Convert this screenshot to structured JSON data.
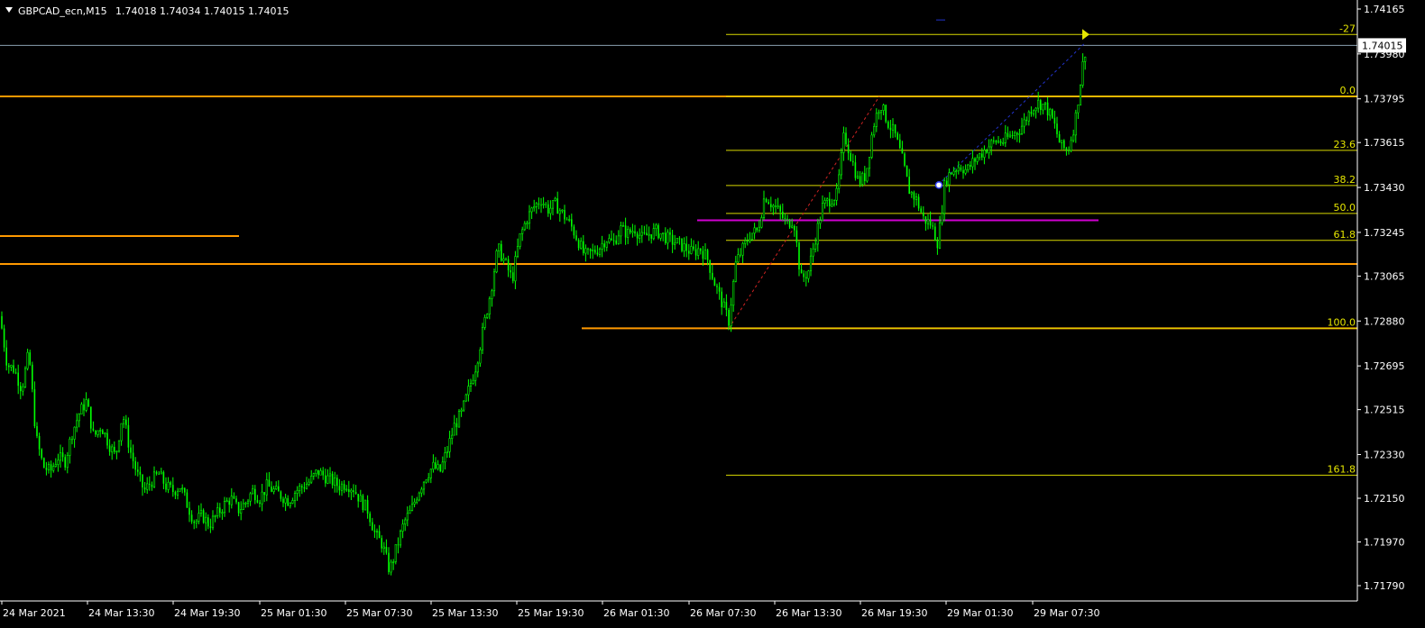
{
  "header": {
    "symbol_line": "GBPCAD_ecn,M15",
    "ohlc_line": "1.74018 1.74034 1.74015 1.74015"
  },
  "colors": {
    "background": "#000000",
    "candle": "#00ff00",
    "axis": "#ffffff",
    "fib": "#d8d800",
    "orange_level": "#ff9900",
    "magenta_level": "#d000d0",
    "bid_line": "#8aa0b0"
  },
  "chart_data": {
    "type": "candlestick",
    "title": "GBPCAD_ecn,M15",
    "ylim": [
      1.717,
      1.7425
    ],
    "y_ticks": [
      "1.74165",
      "1.73980",
      "1.73795",
      "1.73615",
      "1.73430",
      "1.73245",
      "1.73065",
      "1.72880",
      "1.72695",
      "1.72515",
      "1.72330",
      "1.72150",
      "1.71970",
      "1.71790"
    ],
    "x_ticks": [
      "24 Mar 2021",
      "24 Mar 13:30",
      "24 Mar 19:30",
      "25 Mar 01:30",
      "25 Mar 07:30",
      "25 Mar 13:30",
      "25 Mar 19:30",
      "26 Mar 01:30",
      "26 Mar 07:30",
      "26 Mar 13:30",
      "26 Mar 19:30",
      "29 Mar 01:30",
      "29 Mar 07:30"
    ],
    "current_price": "1.74015",
    "close_path": [
      [
        0,
        1.729
      ],
      [
        8,
        1.727
      ],
      [
        16,
        1.7268
      ],
      [
        24,
        1.726
      ],
      [
        32,
        1.7275
      ],
      [
        40,
        1.724
      ],
      [
        48,
        1.7228
      ],
      [
        56,
        1.7226
      ],
      [
        64,
        1.7232
      ],
      [
        72,
        1.723
      ],
      [
        80,
        1.7242
      ],
      [
        88,
        1.725
      ],
      [
        96,
        1.7255
      ],
      [
        104,
        1.724
      ],
      [
        112,
        1.7245
      ],
      [
        120,
        1.7238
      ],
      [
        128,
        1.7232
      ],
      [
        136,
        1.725
      ],
      [
        144,
        1.7235
      ],
      [
        152,
        1.7225
      ],
      [
        160,
        1.7218
      ],
      [
        168,
        1.7222
      ],
      [
        176,
        1.7225
      ],
      [
        184,
        1.722
      ],
      [
        192,
        1.7218
      ],
      [
        200,
        1.722
      ],
      [
        208,
        1.7212
      ],
      [
        216,
        1.7205
      ],
      [
        224,
        1.7208
      ],
      [
        232,
        1.7204
      ],
      [
        240,
        1.7208
      ],
      [
        248,
        1.7212
      ],
      [
        256,
        1.7215
      ],
      [
        264,
        1.721
      ],
      [
        272,
        1.7213
      ],
      [
        280,
        1.7218
      ],
      [
        288,
        1.7215
      ],
      [
        296,
        1.722
      ],
      [
        304,
        1.7218
      ],
      [
        312,
        1.7216
      ],
      [
        320,
        1.7214
      ],
      [
        328,
        1.7218
      ],
      [
        336,
        1.722
      ],
      [
        344,
        1.7222
      ],
      [
        352,
        1.7226
      ],
      [
        360,
        1.7224
      ],
      [
        368,
        1.7222
      ],
      [
        376,
        1.722
      ],
      [
        384,
        1.7221
      ],
      [
        392,
        1.7219
      ],
      [
        400,
        1.7214
      ],
      [
        408,
        1.721
      ],
      [
        416,
        1.72
      ],
      [
        424,
        1.7196
      ],
      [
        432,
        1.7185
      ],
      [
        440,
        1.7195
      ],
      [
        448,
        1.7205
      ],
      [
        456,
        1.721
      ],
      [
        464,
        1.7218
      ],
      [
        472,
        1.7224
      ],
      [
        480,
        1.7228
      ],
      [
        488,
        1.7226
      ],
      [
        496,
        1.7235
      ],
      [
        504,
        1.7245
      ],
      [
        512,
        1.725
      ],
      [
        520,
        1.726
      ],
      [
        528,
        1.727
      ],
      [
        536,
        1.7285
      ],
      [
        544,
        1.73
      ],
      [
        552,
        1.7318
      ],
      [
        560,
        1.7312
      ],
      [
        568,
        1.7305
      ],
      [
        576,
        1.7322
      ],
      [
        584,
        1.733
      ],
      [
        592,
        1.7335
      ],
      [
        600,
        1.7338
      ],
      [
        608,
        1.7334
      ],
      [
        616,
        1.7336
      ],
      [
        624,
        1.7332
      ],
      [
        632,
        1.7328
      ],
      [
        640,
        1.7322
      ],
      [
        648,
        1.7315
      ],
      [
        656,
        1.7316
      ],
      [
        664,
        1.7318
      ],
      [
        672,
        1.7322
      ],
      [
        680,
        1.732
      ],
      [
        688,
        1.7326
      ],
      [
        696,
        1.7324
      ],
      [
        704,
        1.7326
      ],
      [
        712,
        1.7322
      ],
      [
        720,
        1.7324
      ],
      [
        728,
        1.7325
      ],
      [
        736,
        1.7323
      ],
      [
        744,
        1.7321
      ],
      [
        752,
        1.732
      ],
      [
        760,
        1.7318
      ],
      [
        768,
        1.7316
      ],
      [
        776,
        1.7318
      ],
      [
        784,
        1.7314
      ],
      [
        792,
        1.7304
      ],
      [
        800,
        1.7296
      ],
      [
        808,
        1.7288
      ],
      [
        816,
        1.7312
      ],
      [
        824,
        1.7318
      ],
      [
        832,
        1.7324
      ],
      [
        840,
        1.7325
      ],
      [
        848,
        1.734
      ],
      [
        856,
        1.7336
      ],
      [
        864,
        1.7333
      ],
      [
        872,
        1.7328
      ],
      [
        880,
        1.733
      ],
      [
        888,
        1.7305
      ],
      [
        896,
        1.7308
      ],
      [
        904,
        1.7322
      ],
      [
        912,
        1.7335
      ],
      [
        920,
        1.7338
      ],
      [
        928,
        1.734
      ],
      [
        936,
        1.7365
      ],
      [
        944,
        1.7355
      ],
      [
        952,
        1.7345
      ],
      [
        960,
        1.7348
      ],
      [
        968,
        1.7368
      ],
      [
        976,
        1.7378
      ],
      [
        984,
        1.737
      ],
      [
        992,
        1.7365
      ],
      [
        1000,
        1.7355
      ],
      [
        1008,
        1.7342
      ],
      [
        1016,
        1.7338
      ],
      [
        1024,
        1.733
      ],
      [
        1032,
        1.7328
      ],
      [
        1040,
        1.732
      ],
      [
        1048,
        1.7346
      ],
      [
        1056,
        1.735
      ],
      [
        1064,
        1.7352
      ],
      [
        1072,
        1.735
      ],
      [
        1080,
        1.7354
      ],
      [
        1088,
        1.7357
      ],
      [
        1096,
        1.736
      ],
      [
        1104,
        1.7362
      ],
      [
        1112,
        1.7362
      ],
      [
        1120,
        1.7364
      ],
      [
        1128,
        1.7366
      ],
      [
        1136,
        1.737
      ],
      [
        1144,
        1.7376
      ],
      [
        1152,
        1.7378
      ],
      [
        1160,
        1.7376
      ],
      [
        1168,
        1.737
      ],
      [
        1176,
        1.736
      ],
      [
        1184,
        1.7358
      ],
      [
        1192,
        1.737
      ],
      [
        1200,
        1.7392
      ],
      [
        1204,
        1.7401
      ]
    ],
    "fibonacci": [
      {
        "label": "-27",
        "price": 1.7406
      },
      {
        "label": "0.0",
        "price": 1.73805
      },
      {
        "label": "23.6",
        "price": 1.73583
      },
      {
        "label": "38.2",
        "price": 1.73438
      },
      {
        "label": "50.0",
        "price": 1.73323
      },
      {
        "label": "61.8",
        "price": 1.73212
      },
      {
        "label": "100.0",
        "price": 1.7285
      },
      {
        "label": "161.8",
        "price": 1.72245
      }
    ],
    "horizontal_levels": [
      {
        "price": 1.73805,
        "from": 0,
        "to": 1505,
        "color": "#ff9900"
      },
      {
        "price": 1.7323,
        "from": 0,
        "to": 265,
        "color": "#ff9900"
      },
      {
        "price": 1.73115,
        "from": 0,
        "to": 1505,
        "color": "#ff9900"
      },
      {
        "price": 1.7285,
        "from": 645,
        "to": 1505,
        "color": "#ff9900"
      },
      {
        "price": 1.73295,
        "from": 773,
        "to": 1218,
        "color": "#d000d0"
      }
    ],
    "trendlines": [
      {
        "from": [
          808,
          1.7285
        ],
        "to": [
          975,
          1.73805
        ],
        "color": "#cc2222"
      },
      {
        "from": [
          1040,
          1.7344
        ],
        "to": [
          1203,
          1.74025
        ],
        "color": "#2233cc"
      }
    ]
  }
}
